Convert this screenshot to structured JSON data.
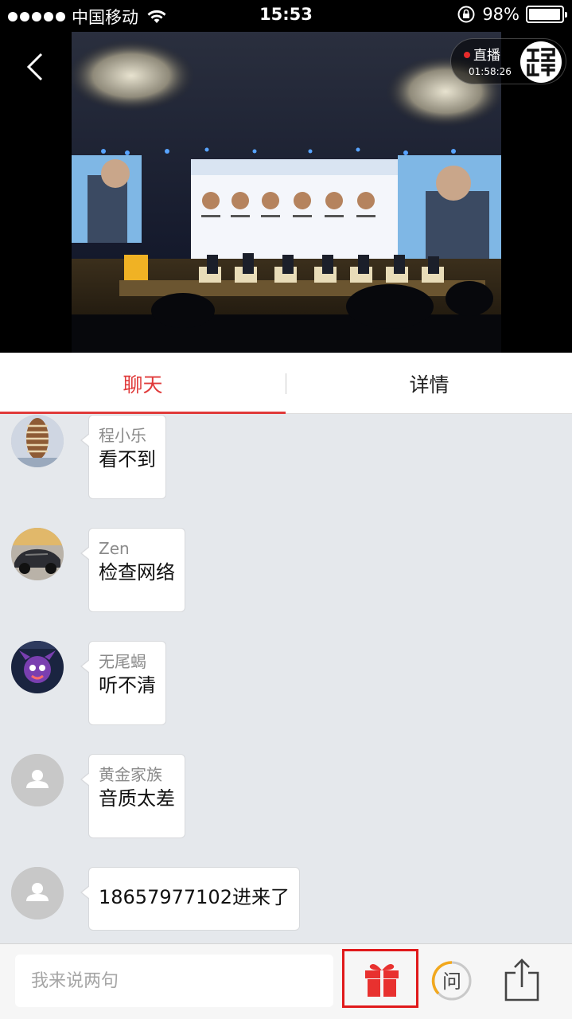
{
  "status_bar": {
    "carrier": "中国移动",
    "time": "15:53",
    "battery": "98%",
    "battery_level": 0.98
  },
  "live": {
    "label": "直播",
    "elapsed": "01:58:26",
    "logo_text": "现场直播"
  },
  "tabs": [
    {
      "label": "聊天",
      "active": true
    },
    {
      "label": "详情",
      "active": false
    }
  ],
  "messages": [
    {
      "sender": "程小乐",
      "text": "看不到"
    },
    {
      "sender": "Zen",
      "text": "检查网络"
    },
    {
      "sender": "无尾蝎",
      "text": "听不清"
    },
    {
      "sender": "黄金家族",
      "text": "音质太差"
    },
    {
      "sender": "",
      "text": "18657977102进来了"
    }
  ],
  "input": {
    "placeholder": "我来说两句"
  },
  "ask_button": {
    "label": "问"
  },
  "colors": {
    "accent": "#e03a3a",
    "gift": "#e8312f",
    "ask_ring": "#f2a81d"
  }
}
